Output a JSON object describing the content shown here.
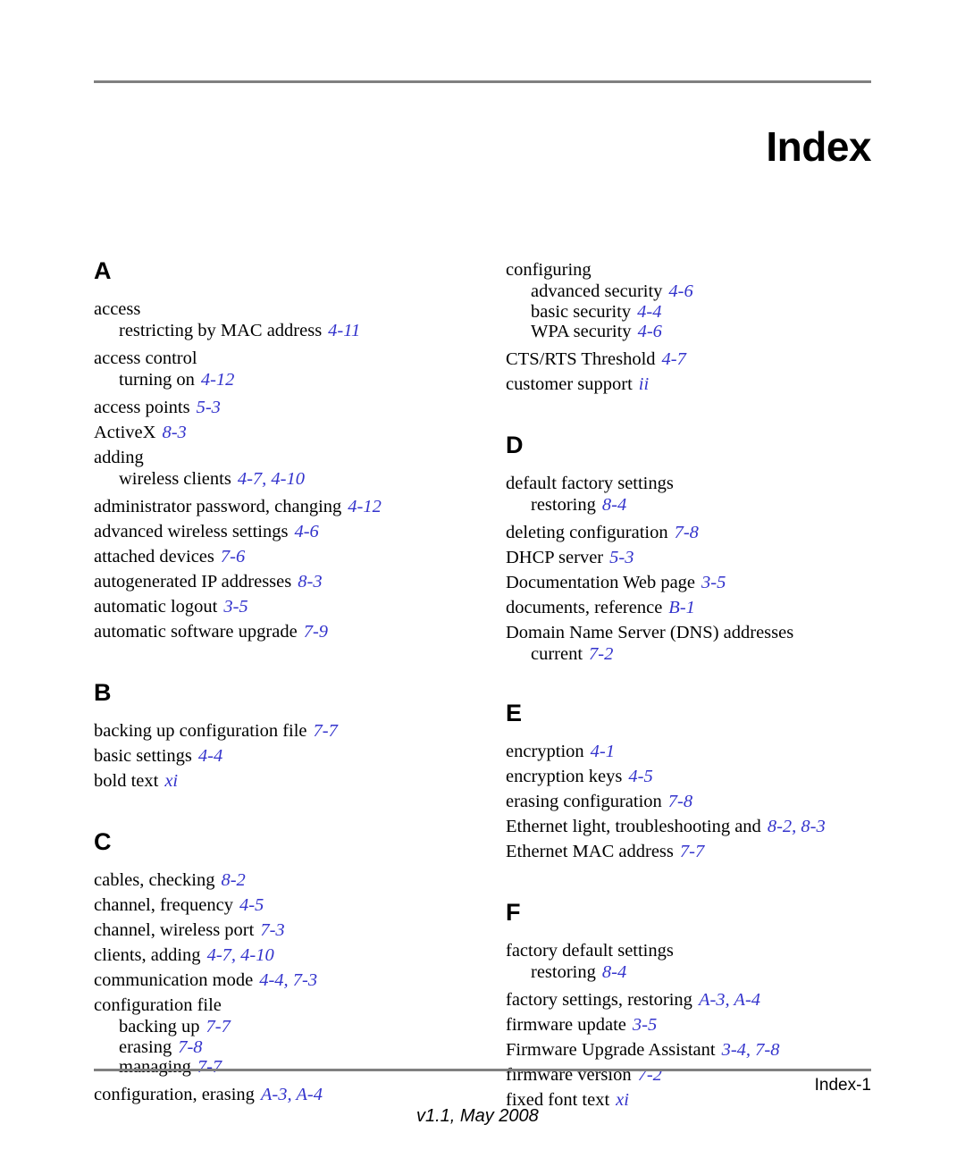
{
  "header": {
    "title": "Index"
  },
  "footer": {
    "page_label": "Index-1",
    "version": "v1.1, May 2008"
  },
  "colors": {
    "reference": "#3333cc",
    "rule": "#808080",
    "text": "#000000"
  },
  "columns": [
    {
      "id": "left",
      "sections": [
        {
          "letter": "A",
          "entries": [
            {
              "level": "main",
              "text": "access",
              "refs": ""
            },
            {
              "level": "sub",
              "text": "restricting by MAC address",
              "refs": "4-11"
            },
            {
              "level": "main",
              "text": "access control",
              "refs": ""
            },
            {
              "level": "sub",
              "text": "turning on",
              "refs": "4-12"
            },
            {
              "level": "main",
              "text": "access points",
              "refs": "5-3"
            },
            {
              "level": "main",
              "text": "ActiveX",
              "refs": "8-3"
            },
            {
              "level": "main",
              "text": "adding",
              "refs": ""
            },
            {
              "level": "sub",
              "text": "wireless clients",
              "refs": "4-7, 4-10"
            },
            {
              "level": "main",
              "text": "administrator password, changing",
              "refs": "4-12"
            },
            {
              "level": "main",
              "text": "advanced wireless settings",
              "refs": "4-6"
            },
            {
              "level": "main",
              "text": "attached devices",
              "refs": "7-6"
            },
            {
              "level": "main",
              "text": "autogenerated IP addresses",
              "refs": "8-3"
            },
            {
              "level": "main",
              "text": "automatic logout",
              "refs": "3-5"
            },
            {
              "level": "main",
              "text": "automatic software upgrade",
              "refs": "7-9"
            }
          ]
        },
        {
          "letter": "B",
          "entries": [
            {
              "level": "main",
              "text": "backing up configuration file",
              "refs": "7-7"
            },
            {
              "level": "main",
              "text": "basic settings",
              "refs": "4-4"
            },
            {
              "level": "main",
              "text": "bold text",
              "refs": "xi"
            }
          ]
        },
        {
          "letter": "C",
          "entries": [
            {
              "level": "main",
              "text": "cables, checking",
              "refs": "8-2"
            },
            {
              "level": "main",
              "text": "channel, frequency",
              "refs": "4-5"
            },
            {
              "level": "main",
              "text": "channel, wireless port",
              "refs": "7-3"
            },
            {
              "level": "main",
              "text": "clients, adding",
              "refs": "4-7, 4-10"
            },
            {
              "level": "main",
              "text": "communication mode",
              "refs": "4-4, 7-3"
            },
            {
              "level": "main",
              "text": "configuration file",
              "refs": ""
            },
            {
              "level": "sub",
              "text": "backing up",
              "refs": "7-7"
            },
            {
              "level": "sub",
              "text": "erasing",
              "refs": "7-8"
            },
            {
              "level": "sub",
              "text": "managing",
              "refs": "7-7"
            },
            {
              "level": "main",
              "text": "configuration, erasing",
              "refs": "A-3, A-4"
            }
          ]
        }
      ]
    },
    {
      "id": "right",
      "sections": [
        {
          "letter": "",
          "continuation": true,
          "entries": [
            {
              "level": "main",
              "text": "configuring",
              "refs": ""
            },
            {
              "level": "sub",
              "text": "advanced security",
              "refs": "4-6"
            },
            {
              "level": "sub",
              "text": "basic security",
              "refs": "4-4"
            },
            {
              "level": "sub",
              "text": "WPA security",
              "refs": "4-6"
            },
            {
              "level": "main",
              "text": "CTS/RTS Threshold",
              "refs": "4-7"
            },
            {
              "level": "main",
              "text": "customer support",
              "refs": "ii"
            }
          ]
        },
        {
          "letter": "D",
          "entries": [
            {
              "level": "main",
              "text": "default factory settings",
              "refs": ""
            },
            {
              "level": "sub",
              "text": "restoring",
              "refs": "8-4"
            },
            {
              "level": "main",
              "text": "deleting configuration",
              "refs": "7-8"
            },
            {
              "level": "main",
              "text": "DHCP server",
              "refs": "5-3"
            },
            {
              "level": "main",
              "text": "Documentation Web page",
              "refs": "3-5"
            },
            {
              "level": "main",
              "text": "documents, reference",
              "refs": "B-1"
            },
            {
              "level": "main",
              "text": "Domain Name Server (DNS) addresses",
              "refs": ""
            },
            {
              "level": "sub",
              "text": "current",
              "refs": "7-2"
            }
          ]
        },
        {
          "letter": "E",
          "entries": [
            {
              "level": "main",
              "text": "encryption",
              "refs": "4-1"
            },
            {
              "level": "main",
              "text": "encryption keys",
              "refs": "4-5"
            },
            {
              "level": "main",
              "text": "erasing configuration",
              "refs": "7-8"
            },
            {
              "level": "main",
              "text": "Ethernet light, troubleshooting and",
              "refs": "8-2, 8-3"
            },
            {
              "level": "main",
              "text": "Ethernet MAC address",
              "refs": "7-7"
            }
          ]
        },
        {
          "letter": "F",
          "entries": [
            {
              "level": "main",
              "text": "factory default settings",
              "refs": ""
            },
            {
              "level": "sub",
              "text": "restoring",
              "refs": "8-4"
            },
            {
              "level": "main",
              "text": "factory settings, restoring",
              "refs": "A-3, A-4"
            },
            {
              "level": "main",
              "text": "firmware update",
              "refs": "3-5"
            },
            {
              "level": "main",
              "text": "Firmware Upgrade Assistant",
              "refs": "3-4, 7-8"
            },
            {
              "level": "main",
              "text": "firmware version",
              "refs": "7-2"
            },
            {
              "level": "main",
              "text": "fixed font text",
              "refs": "xi"
            }
          ]
        }
      ]
    }
  ]
}
